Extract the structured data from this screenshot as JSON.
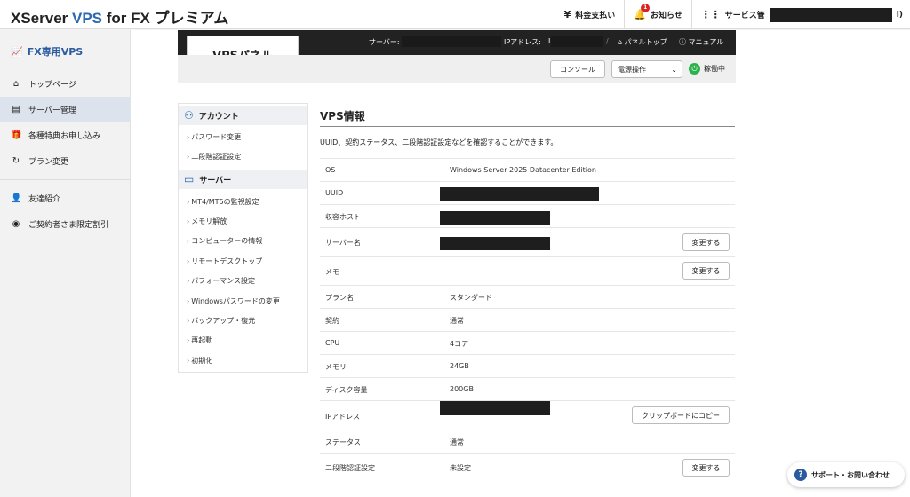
{
  "header": {
    "brand_x": "XServer ",
    "brand_vps": "VPS",
    "brand_rest": " for FX プレミアム",
    "nav": [
      {
        "label": "料金支払い",
        "icon": "yen-icon"
      },
      {
        "label": "お知らせ",
        "icon": "bell-icon",
        "badge": "1"
      },
      {
        "label": "サービス管",
        "icon": "grid-icon",
        "suffix": "i)"
      }
    ]
  },
  "sidebar": {
    "title": "FX専用VPS",
    "items": [
      {
        "label": "トップページ",
        "icon": "home-icon"
      },
      {
        "label": "サーバー管理",
        "icon": "server-icon"
      },
      {
        "label": "各種特典お申し込み",
        "icon": "gift-icon"
      },
      {
        "label": "プラン変更",
        "icon": "refresh-icon"
      },
      {
        "label": "友達紹介",
        "icon": "friend-icon"
      },
      {
        "label": "ご契約者さま限定割引",
        "icon": "discount-icon"
      }
    ]
  },
  "panel": {
    "logo": "VPSパネル",
    "server_label": "サーバー:",
    "ip_label": "IPアドレス:",
    "ip_prefix": "I",
    "slash": "/",
    "panel_top": "パネルトップ",
    "manual": "マニュアル",
    "console": "コンソール",
    "power_select": "電源操作",
    "status": "稼働中"
  },
  "menu": {
    "account_head": "アカウント",
    "account_links": [
      "パスワード変更",
      "二段階認証設定"
    ],
    "server_head": "サーバー",
    "server_links": [
      "MT4/MT5の監視設定",
      "メモリ解放",
      "コンピューターの情報",
      "リモートデスクトップ",
      "パフォーマンス設定",
      "Windowsパスワードの変更",
      "バックアップ・復元",
      "再起動",
      "初期化"
    ]
  },
  "info": {
    "title": "VPS情報",
    "desc": "UUID、契約ステータス、二段階認証設定などを確認することができます。",
    "rows": [
      {
        "key": "OS",
        "value": "Windows Server 2025 Datacenter Edition"
      },
      {
        "key": "UUID",
        "value": ""
      },
      {
        "key": "収容ホスト",
        "value": ""
      },
      {
        "key": "サーバー名",
        "value": "",
        "button": "変更する"
      },
      {
        "key": "メモ",
        "value": "",
        "button": "変更する"
      },
      {
        "key": "プラン名",
        "value": "スタンダード"
      },
      {
        "key": "契約",
        "value": "通常"
      },
      {
        "key": "CPU",
        "value": "4コア"
      },
      {
        "key": "メモリ",
        "value": "24GB"
      },
      {
        "key": "ディスク容量",
        "value": "200GB"
      },
      {
        "key": "IPアドレス",
        "value": "",
        "button": "クリップボードにコピー"
      },
      {
        "key": "ステータス",
        "value": "通常"
      },
      {
        "key": "二段階認証設定",
        "value": "未設定",
        "button": "変更する"
      }
    ]
  },
  "support": {
    "label": "サポート・お問い合わせ"
  }
}
